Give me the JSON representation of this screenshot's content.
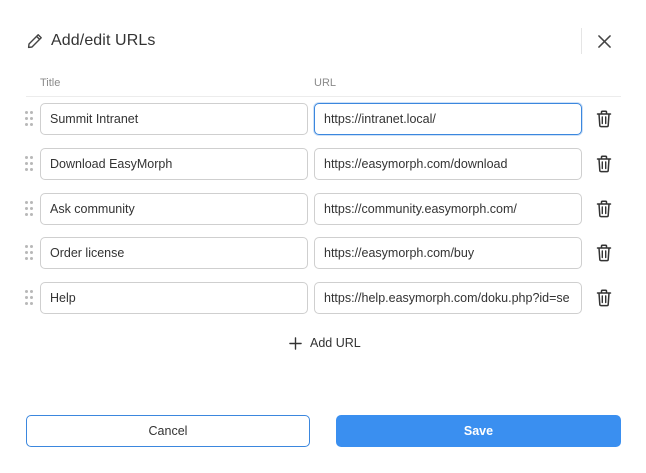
{
  "dialog": {
    "title": "Add/edit URLs",
    "title_icon": "pencil-icon",
    "close_icon": "close-icon"
  },
  "columns": {
    "title": "Title",
    "url": "URL"
  },
  "rows": [
    {
      "title": "Summit Intranet",
      "url": "https://intranet.local/",
      "focused": true
    },
    {
      "title": "Download EasyMorph",
      "url": "https://easymorph.com/download"
    },
    {
      "title": "Ask community",
      "url": "https://community.easymorph.com/"
    },
    {
      "title": "Order license",
      "url": "https://easymorph.com/buy"
    },
    {
      "title": "Help",
      "url": "https://help.easymorph.com/doku.php?id=se"
    }
  ],
  "add_url": {
    "label": "Add URL",
    "icon": "plus-icon"
  },
  "footer": {
    "cancel_label": "Cancel",
    "save_label": "Save"
  },
  "colors": {
    "accent": "#3a8ff0",
    "focus_border": "#3b87de",
    "border": "#cfcfcf"
  }
}
